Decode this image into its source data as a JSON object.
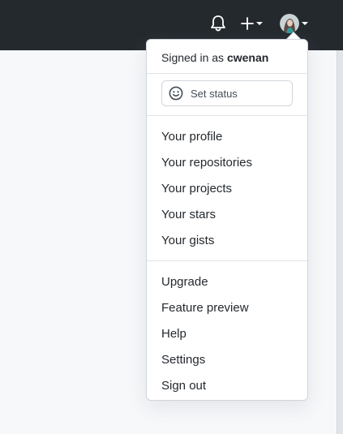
{
  "topbar": {
    "notifications_icon": "bell-icon",
    "create_icon": "plus-icon",
    "avatar_icon": "user-avatar"
  },
  "dropdown": {
    "signed_in_prefix": "Signed in as",
    "username": "cwenan",
    "status_label": "Set status",
    "status_icon": "smiley-icon",
    "profile_items": [
      {
        "label": "Your profile"
      },
      {
        "label": "Your repositories"
      },
      {
        "label": "Your projects"
      },
      {
        "label": "Your stars"
      },
      {
        "label": "Your gists"
      }
    ],
    "account_items": [
      {
        "label": "Upgrade"
      },
      {
        "label": "Feature preview"
      },
      {
        "label": "Help"
      },
      {
        "label": "Settings"
      },
      {
        "label": "Sign out"
      }
    ]
  },
  "colors": {
    "header_bg": "#24292e",
    "page_bg": "#f6f8fa",
    "text": "#24292e",
    "border": "#d1d5da"
  }
}
